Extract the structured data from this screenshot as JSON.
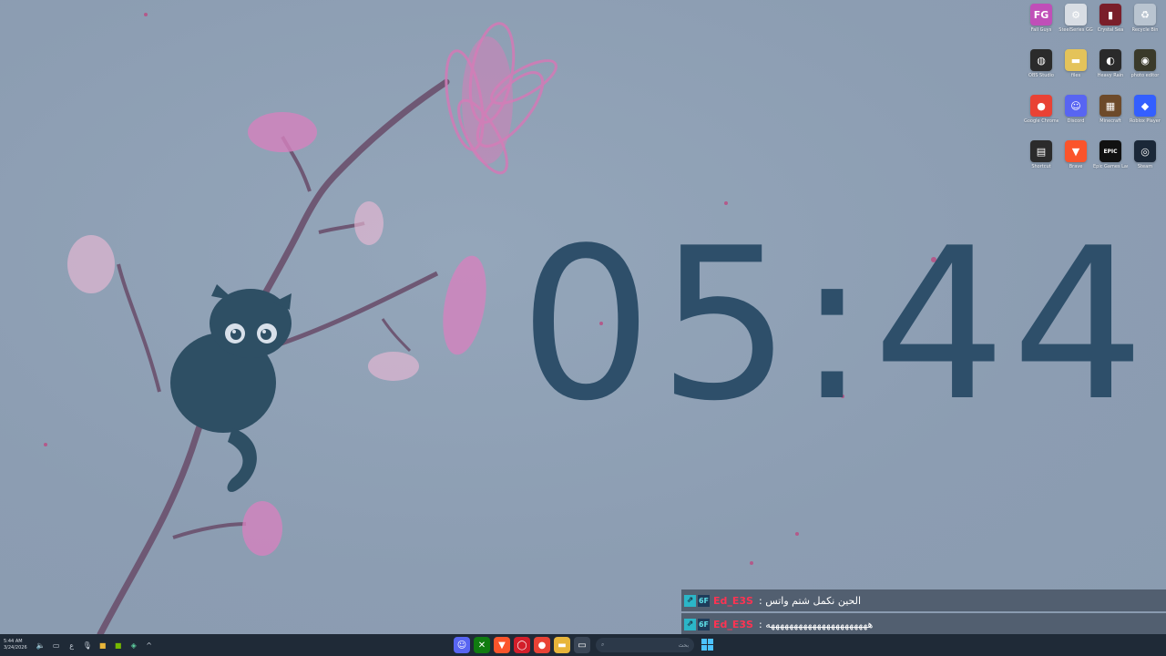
{
  "clock": {
    "time": "05:44"
  },
  "desktop": {
    "icons": [
      {
        "label": "Recycle Bin",
        "glyph": "♻",
        "color": "#b9c4d0"
      },
      {
        "label": "Crystal Sea",
        "glyph": "▮",
        "color": "#7a1e2a"
      },
      {
        "label": "SteelSeries GG",
        "glyph": "⚙",
        "color": "#d8dde4"
      },
      {
        "label": "Fall Guys",
        "glyph": "FG",
        "color": "#c04fb8"
      },
      {
        "label": "photo editor",
        "glyph": "◉",
        "color": "#3a3a2a"
      },
      {
        "label": "Heavy Rain",
        "glyph": "◐",
        "color": "#2a2a2a"
      },
      {
        "label": "files",
        "glyph": "▬",
        "color": "#e4c35a"
      },
      {
        "label": "OBS Studio",
        "glyph": "◍",
        "color": "#2b2b2b"
      },
      {
        "label": "Roblox Player",
        "glyph": "◆",
        "color": "#335fff"
      },
      {
        "label": "Minecraft",
        "glyph": "▦",
        "color": "#6d4a2a"
      },
      {
        "label": "Discord",
        "glyph": "☺",
        "color": "#5865f2"
      },
      {
        "label": "Google Chrome",
        "glyph": "●",
        "color": "#e94235"
      },
      {
        "label": "Steam",
        "glyph": "◎",
        "color": "#1b2838"
      },
      {
        "label": "Epic Games Launcher",
        "glyph": "EPIC",
        "color": "#111111"
      },
      {
        "label": "Brave",
        "glyph": "▼",
        "color": "#fb542b"
      },
      {
        "label": "Shortcut",
        "glyph": "▤",
        "color": "#2b2b2b"
      }
    ]
  },
  "chat": {
    "messages": [
      {
        "badge1": "⇗",
        "badge2": "6F",
        "user": "Ed_E3S",
        "text": ": الحين نكمل شتم واتس"
      },
      {
        "badge1": "⇗",
        "badge2": "6F",
        "user": "Ed_E3S",
        "text": ": ههههههههههههههههههههههه"
      }
    ]
  },
  "taskbar": {
    "time": "5:44 AM",
    "date": "3/24/2026",
    "tray_icons": [
      "volume-icon",
      "display-icon",
      "language-icon",
      "mic-icon",
      "folder-icon",
      "nvidia-icon",
      "network-icon",
      "chevron-up-icon"
    ],
    "language": "ع",
    "search_placeholder": "بحث",
    "apps": [
      {
        "name": "discord",
        "glyph": "☺",
        "color": "#5865f2"
      },
      {
        "name": "xbox",
        "glyph": "✕",
        "color": "#107c10"
      },
      {
        "name": "brave",
        "glyph": "▼",
        "color": "#fb542b"
      },
      {
        "name": "opera",
        "glyph": "◯",
        "color": "#d31e2a"
      },
      {
        "name": "chrome",
        "glyph": "●",
        "color": "#e94235"
      },
      {
        "name": "file-explorer",
        "glyph": "▬",
        "color": "#e8b53a"
      },
      {
        "name": "task-view",
        "glyph": "▭",
        "color": "#3a4656"
      }
    ]
  }
}
